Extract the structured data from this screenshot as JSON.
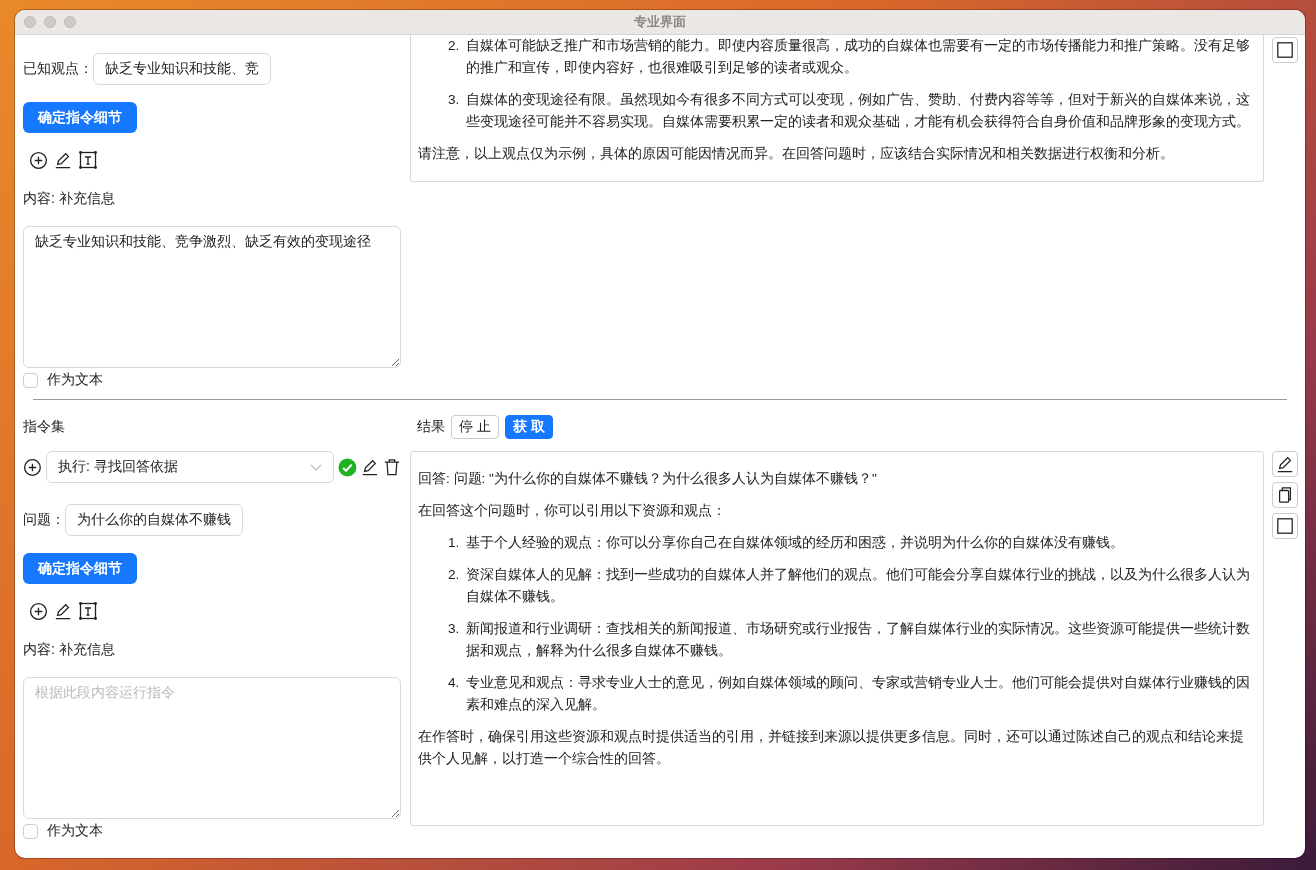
{
  "window": {
    "title": "专业界面"
  },
  "sections": [
    {
      "left": {
        "fields": [
          {
            "label": "已知观点：",
            "value": "缺乏专业知识和技能、竞"
          }
        ],
        "confirm_button": "确定指令细节",
        "content_label": "内容: 补充信息",
        "content": {
          "value": "缺乏专业知识和技能、竞争激烈、缺乏有效的变现途径"
        },
        "as_text": {
          "label": "作为文本",
          "checked": false
        }
      },
      "result": {
        "cut_top": true,
        "blocks": [
          {
            "kind": "item",
            "number": "2.",
            "text": "自媒体可能缺乏推广和市场营销的能力。即使内容质量很高，成功的自媒体也需要有一定的市场传播能力和推广策略。没有足够的推广和宣传，即使内容好，也很难吸引到足够的读者或观众。"
          },
          {
            "kind": "item",
            "number": "3.",
            "text": "自媒体的变现途径有限。虽然现如今有很多不同方式可以变现，例如广告、赞助、付费内容等等，但对于新兴的自媒体来说，这些变现途径可能并不容易实现。自媒体需要积累一定的读者和观众基础，才能有机会获得符合自身价值和品牌形象的变现方式。"
          },
          {
            "kind": "paragraph",
            "text": "请注意，以上观点仅为示例，具体的原因可能因情况而异。在回答问题时，应该结合实际情况和相关数据进行权衡和分析。"
          }
        ]
      },
      "side_tools": [
        {
          "kind": "square"
        }
      ]
    },
    {
      "header": {
        "title": "指令集",
        "result_label": "结果",
        "buttons": [
          {
            "label": "停 止",
            "kind": "default"
          },
          {
            "label": "获 取",
            "kind": "primary"
          }
        ]
      },
      "left": {
        "instruction": {
          "value": "执行: 寻找回答依据",
          "done": true
        },
        "fields": [
          {
            "label": "问题：",
            "value": "为什么你的自媒体不赚钱"
          }
        ],
        "confirm_button": "确定指令细节",
        "content_label": "内容: 补充信息",
        "content": {
          "placeholder": "根据此段内容运行指令"
        },
        "as_text": {
          "label": "作为文本",
          "checked": false
        }
      },
      "result": {
        "cut_top": false,
        "blocks": [
          {
            "kind": "paragraph",
            "text": "回答: 问题: \"为什么你的自媒体不赚钱？为什么很多人认为自媒体不赚钱？\""
          },
          {
            "kind": "paragraph",
            "text": "在回答这个问题时，你可以引用以下资源和观点："
          },
          {
            "kind": "item",
            "number": "1.",
            "text": "基于个人经验的观点：你可以分享你自己在自媒体领域的经历和困惑，并说明为什么你的自媒体没有赚钱。"
          },
          {
            "kind": "item",
            "number": "2.",
            "text": "资深自媒体人的见解：找到一些成功的自媒体人并了解他们的观点。他们可能会分享自媒体行业的挑战，以及为什么很多人认为自媒体不赚钱。"
          },
          {
            "kind": "item",
            "number": "3.",
            "text": "新闻报道和行业调研：查找相关的新闻报道、市场研究或行业报告，了解自媒体行业的实际情况。这些资源可能提供一些统计数据和观点，解释为什么很多自媒体不赚钱。"
          },
          {
            "kind": "item",
            "number": "4.",
            "text": "专业意见和观点：寻求专业人士的意见，例如自媒体领域的顾问、专家或营销专业人士。他们可能会提供对自媒体行业赚钱的因素和难点的深入见解。"
          },
          {
            "kind": "paragraph",
            "text": "在作答时，确保引用这些资源和观点时提供适当的引用，并链接到来源以提供更多信息。同时，还可以通过陈述自己的观点和结论来提供个人见解，以打造一个综合性的回答。"
          }
        ]
      },
      "side_tools": [
        {
          "kind": "edit"
        },
        {
          "kind": "copy"
        },
        {
          "kind": "square"
        }
      ]
    }
  ]
}
